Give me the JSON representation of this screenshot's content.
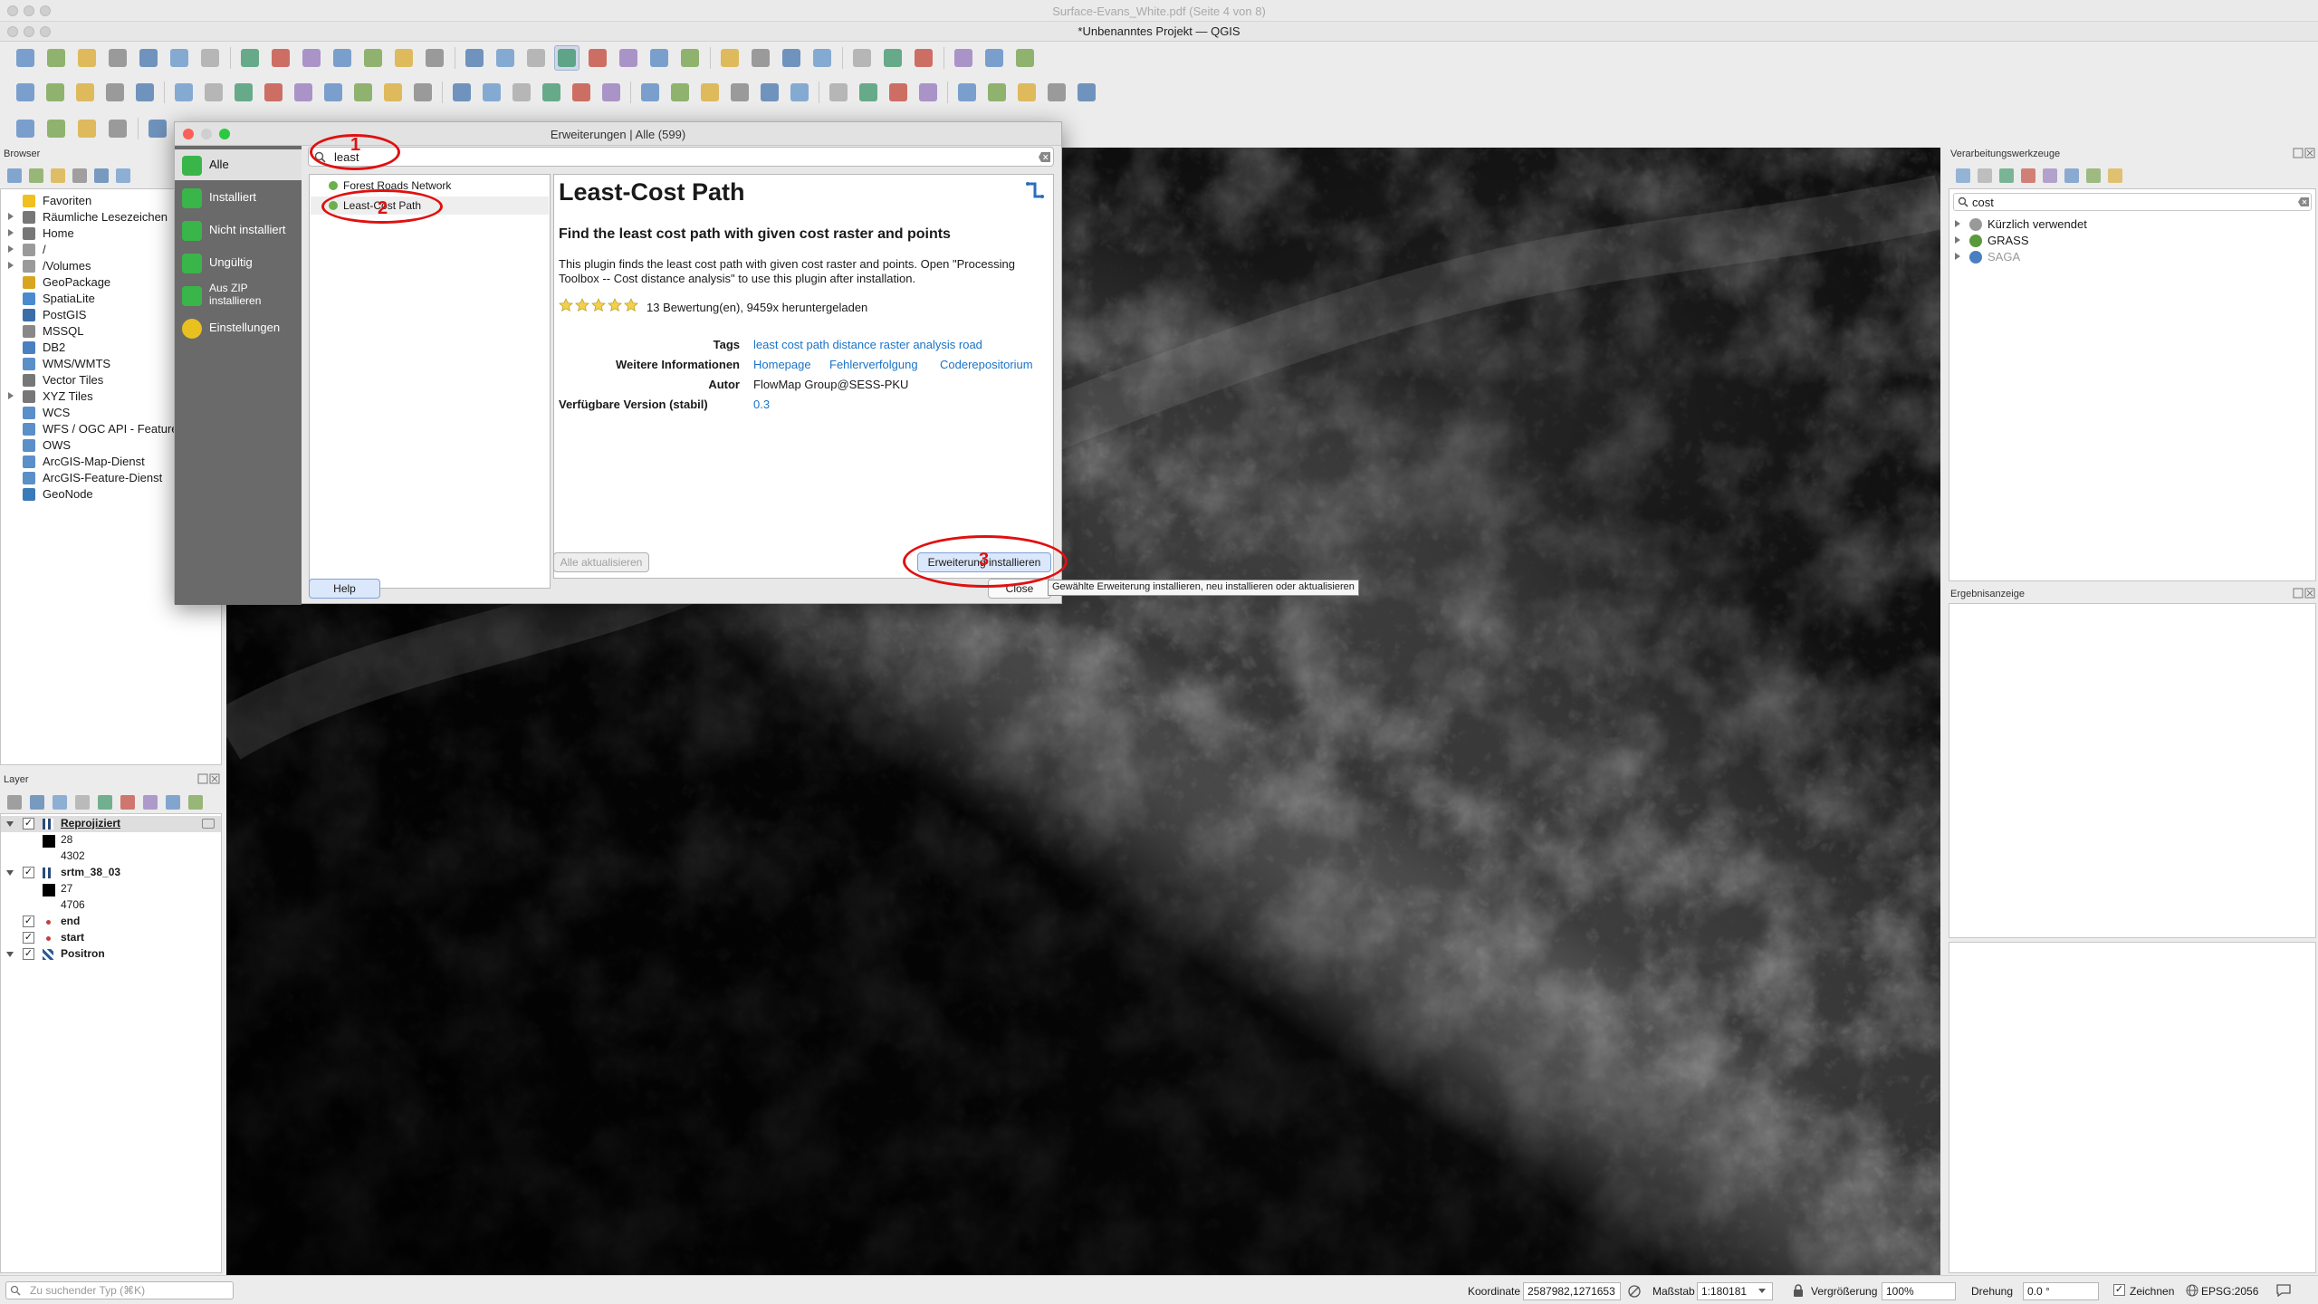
{
  "pdf_window": {
    "title": "Surface-Evans_White.pdf (Seite 4 von 8)"
  },
  "window": {
    "title": "*Unbenanntes Projekt — QGIS"
  },
  "icons": {
    "toolbar_count": "many",
    "pan": "hand-icon",
    "python": "python-icon",
    "help": "help-icon"
  },
  "browser": {
    "title": "Browser",
    "items": [
      {
        "label": "Favoriten",
        "icon": "star-icon",
        "color": "#f0c020",
        "expand": false
      },
      {
        "label": "Räumliche Lesezeichen",
        "icon": "bookmark-icon",
        "color": "#777777",
        "expand": true
      },
      {
        "label": "Home",
        "icon": "home-icon",
        "color": "#777777",
        "expand": true
      },
      {
        "label": "/",
        "icon": "folder-icon",
        "color": "#9a9a9a",
        "expand": true
      },
      {
        "label": "/Volumes",
        "icon": "folder-icon",
        "color": "#9a9a9a",
        "expand": true
      },
      {
        "label": "GeoPackage",
        "icon": "geopackage-icon",
        "color": "#d9a520",
        "expand": false
      },
      {
        "label": "SpatiaLite",
        "icon": "spatialite-icon",
        "color": "#4a8bd0",
        "expand": false
      },
      {
        "label": "PostGIS",
        "icon": "postgis-icon",
        "color": "#3b6ea8",
        "expand": false
      },
      {
        "label": "MSSQL",
        "icon": "mssql-icon",
        "color": "#888888",
        "expand": false
      },
      {
        "label": "DB2",
        "icon": "db2-icon",
        "color": "#4a7fc0",
        "expand": false
      },
      {
        "label": "WMS/WMTS",
        "icon": "globe-icon",
        "color": "#5a8fc8",
        "expand": false
      },
      {
        "label": "Vector Tiles",
        "icon": "grid-icon",
        "color": "#777777",
        "expand": false
      },
      {
        "label": "XYZ Tiles",
        "icon": "grid-icon",
        "color": "#777777",
        "expand": true
      },
      {
        "label": "WCS",
        "icon": "globe-icon",
        "color": "#5a8fc8",
        "expand": false
      },
      {
        "label": "WFS / OGC API - Feature",
        "icon": "globe-icon",
        "color": "#5a8fc8",
        "expand": false
      },
      {
        "label": "OWS",
        "icon": "globe-icon",
        "color": "#5a8fc8",
        "expand": false
      },
      {
        "label": "ArcGIS-Map-Dienst",
        "icon": "globe-icon",
        "color": "#5a8fc8",
        "expand": false
      },
      {
        "label": "ArcGIS-Feature-Dienst",
        "icon": "globe-icon",
        "color": "#5a8fc8",
        "expand": false
      },
      {
        "label": "GeoNode",
        "icon": "geonode-icon",
        "color": "#3a7ab8",
        "expand": false
      }
    ]
  },
  "layers": {
    "title": "Layer",
    "items": [
      {
        "label": "Reprojiziert",
        "bold": true,
        "underline": true,
        "checkbox": true,
        "expand": true,
        "kind": "raster"
      },
      {
        "label": "28",
        "legend": true,
        "swatch": "#000000"
      },
      {
        "label": "4302",
        "legend": true,
        "swatch": ""
      },
      {
        "label": "srtm_38_03",
        "bold": true,
        "checkbox": true,
        "expand": true,
        "kind": "raster"
      },
      {
        "label": "27",
        "legend": true,
        "swatch": "#000000"
      },
      {
        "label": "4706",
        "legend": true,
        "swatch": ""
      },
      {
        "label": "end",
        "bold": true,
        "checkbox": true,
        "kind": "point"
      },
      {
        "label": "start",
        "bold": true,
        "checkbox": true,
        "kind": "point"
      },
      {
        "label": "Positron",
        "bold": true,
        "checkbox": true,
        "expand": true,
        "kind": "tile"
      }
    ]
  },
  "processing": {
    "title": "Verarbeitungswerkzeuge",
    "search_value": "cost",
    "items": [
      {
        "label": "Kürzlich verwendet",
        "icon": "clock-icon"
      },
      {
        "label": "GRASS",
        "icon": "grass-icon"
      },
      {
        "label": "SAGA",
        "icon": "saga-icon",
        "dim": true
      }
    ]
  },
  "results": {
    "title": "Ergebnisanzeige"
  },
  "dialog": {
    "title": "Erweiterungen | Alle (599)",
    "sidebar": [
      {
        "label": "Alle",
        "icon": "puzzle-icon",
        "selected": true
      },
      {
        "label": "Installiert",
        "icon": "puzzle-icon"
      },
      {
        "label": "Nicht installiert",
        "icon": "puzzle-icon"
      },
      {
        "label": "Ungültig",
        "icon": "puzzle-icon"
      },
      {
        "label": "Aus ZIP installieren",
        "icon": "zip-icon"
      },
      {
        "label": "Einstellungen",
        "icon": "settings-icon"
      }
    ],
    "search_value": "least",
    "plugins": [
      {
        "label": "Forest Roads Network",
        "selected": false
      },
      {
        "label": "Least-Cost Path",
        "selected": true
      }
    ],
    "detail": {
      "title": "Least-Cost Path",
      "subtitle": "Find the least cost path with given cost raster and points",
      "description": "This plugin finds the least cost path with given cost raster and points. Open \"Processing Toolbox -- Cost distance analysis\" to use this plugin after installation.",
      "rating": 5,
      "rating_text": "13 Bewertung(en), 9459x heruntergeladen",
      "tags_label": "Tags",
      "tags_value": "least cost path distance raster analysis road",
      "info_label": "Weitere Informationen",
      "info_links": [
        "Homepage",
        "Fehlerverfolgung",
        "Coderepositorium"
      ],
      "author_label": "Autor",
      "author_value": "FlowMap Group@SESS-PKU",
      "version_label": "Verfügbare Version (stabil)",
      "version_value": "0.3"
    },
    "buttons": {
      "update_all": "Alle aktualisieren",
      "install": "Erweiterung installieren",
      "help": "Help",
      "close": "Close"
    },
    "tooltip": "Gewählte Erweiterung installieren, neu installieren oder aktualisieren",
    "annotations": [
      "1",
      "2",
      "3"
    ],
    "annotation_color": "#e01010"
  },
  "status": {
    "locator_placeholder": "Zu suchender Typ (⌘K)",
    "coord_label": "Koordinate",
    "coord_value": "2587982,1271653",
    "scale_label": "Maßstab",
    "scale_value": "1:180181",
    "magnifier_label": "Vergrößerung",
    "magnifier_value": "100%",
    "rotation_label": "Drehung",
    "rotation_value": "0.0 °",
    "render_label": "Zeichnen",
    "crs_value": "EPSG:2056"
  }
}
